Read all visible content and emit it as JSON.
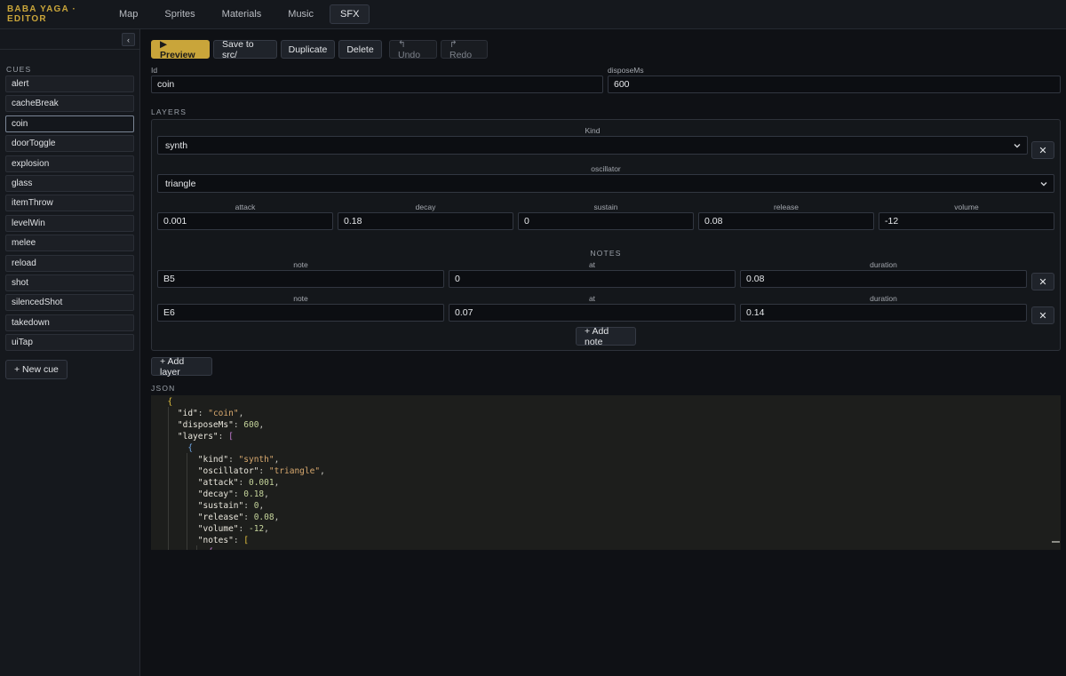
{
  "app": {
    "brand": "BABA YAGA · EDITOR"
  },
  "nav": {
    "tabs": [
      "Map",
      "Sprites",
      "Materials",
      "Music",
      "SFX"
    ],
    "active": "SFX"
  },
  "sidebar": {
    "collapse_glyph": "‹",
    "cues_label": "CUES",
    "cues": [
      "alert",
      "cacheBreak",
      "coin",
      "doorToggle",
      "explosion",
      "glass",
      "itemThrow",
      "levelWin",
      "melee",
      "reload",
      "shot",
      "silencedShot",
      "takedown",
      "uiTap"
    ],
    "selected_cue": "coin",
    "new_cue_label": "+ New cue"
  },
  "toolbar": {
    "preview_label": "▶ Preview",
    "save_label": "Save to src/",
    "duplicate_label": "Duplicate",
    "delete_label": "Delete",
    "undo_label": "↰ Undo",
    "redo_label": "↱ Redo"
  },
  "form": {
    "id_label": "Id",
    "id_value": "coin",
    "dispose_label": "disposeMs",
    "dispose_value": "600",
    "layers_label": "LAYERS"
  },
  "layer": {
    "kind_label": "Kind",
    "kind_value": "synth",
    "osc_label": "oscillator",
    "osc_value": "triangle",
    "envelope": [
      {
        "label": "attack",
        "value": "0.001"
      },
      {
        "label": "decay",
        "value": "0.18"
      },
      {
        "label": "sustain",
        "value": "0"
      },
      {
        "label": "release",
        "value": "0.08"
      },
      {
        "label": "volume",
        "value": "-12"
      }
    ],
    "notes_label": "NOTES",
    "note_headers": [
      "note",
      "at",
      "duration"
    ],
    "notes": [
      {
        "note": "B5",
        "at": "0",
        "duration": "0.08"
      },
      {
        "note": "E6",
        "at": "0.07",
        "duration": "0.14"
      }
    ],
    "remove_glyph": "✕",
    "add_note_label": "+ Add note"
  },
  "add_layer_label": "+ Add layer",
  "json_label": "JSON",
  "json_lines": [
    {
      "indent": "  ",
      "parts": [
        [
          "b1",
          "{"
        ]
      ]
    },
    {
      "indent": "    ",
      "parts": [
        [
          "k",
          "\"id\""
        ],
        [
          "p",
          ": "
        ],
        [
          "s",
          "\"coin\""
        ],
        [
          "p",
          ","
        ]
      ]
    },
    {
      "indent": "    ",
      "parts": [
        [
          "k",
          "\"disposeMs\""
        ],
        [
          "p",
          ": "
        ],
        [
          "n",
          "600"
        ],
        [
          "p",
          ","
        ]
      ]
    },
    {
      "indent": "    ",
      "parts": [
        [
          "k",
          "\"layers\""
        ],
        [
          "p",
          ": "
        ],
        [
          "b2",
          "["
        ]
      ]
    },
    {
      "indent": "      ",
      "parts": [
        [
          "b3",
          "{"
        ]
      ]
    },
    {
      "indent": "        ",
      "parts": [
        [
          "k",
          "\"kind\""
        ],
        [
          "p",
          ": "
        ],
        [
          "s",
          "\"synth\""
        ],
        [
          "p",
          ","
        ]
      ]
    },
    {
      "indent": "        ",
      "parts": [
        [
          "k",
          "\"oscillator\""
        ],
        [
          "p",
          ": "
        ],
        [
          "s",
          "\"triangle\""
        ],
        [
          "p",
          ","
        ]
      ]
    },
    {
      "indent": "        ",
      "parts": [
        [
          "k",
          "\"attack\""
        ],
        [
          "p",
          ": "
        ],
        [
          "n",
          "0.001"
        ],
        [
          "p",
          ","
        ]
      ]
    },
    {
      "indent": "        ",
      "parts": [
        [
          "k",
          "\"decay\""
        ],
        [
          "p",
          ": "
        ],
        [
          "n",
          "0.18"
        ],
        [
          "p",
          ","
        ]
      ]
    },
    {
      "indent": "        ",
      "parts": [
        [
          "k",
          "\"sustain\""
        ],
        [
          "p",
          ": "
        ],
        [
          "n",
          "0"
        ],
        [
          "p",
          ","
        ]
      ]
    },
    {
      "indent": "        ",
      "parts": [
        [
          "k",
          "\"release\""
        ],
        [
          "p",
          ": "
        ],
        [
          "n",
          "0.08"
        ],
        [
          "p",
          ","
        ]
      ]
    },
    {
      "indent": "        ",
      "parts": [
        [
          "k",
          "\"volume\""
        ],
        [
          "p",
          ": "
        ],
        [
          "n",
          "-12"
        ],
        [
          "p",
          ","
        ]
      ]
    },
    {
      "indent": "        ",
      "parts": [
        [
          "k",
          "\"notes\""
        ],
        [
          "p",
          ": "
        ],
        [
          "b1",
          "["
        ]
      ]
    },
    {
      "indent": "          ",
      "parts": [
        [
          "b2",
          "{"
        ]
      ]
    }
  ],
  "colors": {
    "accent": "#c9a53a",
    "background": "#0f1115",
    "panel": "#15181d"
  }
}
